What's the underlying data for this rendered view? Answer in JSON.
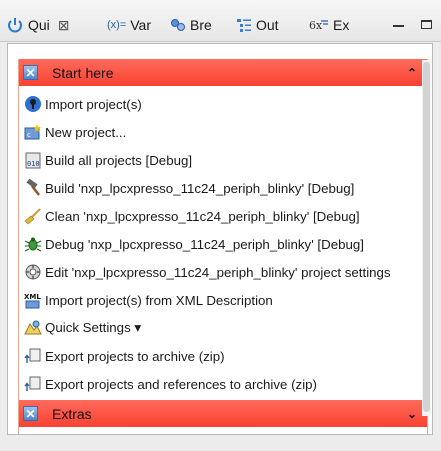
{
  "tabs": [
    {
      "label": "Qui",
      "icon": "power-icon",
      "close": "⊠"
    },
    {
      "label": "Var",
      "icon": "variables-icon",
      "prefix": "(x)="
    },
    {
      "label": "Bre",
      "icon": "breakpoints-icon"
    },
    {
      "label": "Out",
      "icon": "outline-icon"
    },
    {
      "label": "Ex",
      "icon": "expressions-icon"
    }
  ],
  "sections": {
    "start": {
      "title": "Start here",
      "chevron": "⌃"
    },
    "extras": {
      "title": "Extras",
      "chevron": "⌄"
    }
  },
  "items": [
    {
      "label": "Import project(s)",
      "icon": "import-icon"
    },
    {
      "label": "New project...",
      "icon": "new-project-icon"
    },
    {
      "label": "Build all projects [Debug]",
      "icon": "build-all-icon"
    },
    {
      "label": "Build 'nxp_lpcxpresso_11c24_periph_blinky' [Debug]",
      "icon": "hammer-icon"
    },
    {
      "label": "Clean 'nxp_lpcxpresso_11c24_periph_blinky' [Debug]",
      "icon": "broom-icon"
    },
    {
      "label": "Debug 'nxp_lpcxpresso_11c24_periph_blinky' [Debug]",
      "icon": "bug-icon"
    },
    {
      "label": "Edit 'nxp_lpcxpresso_11c24_periph_blinky' project settings",
      "icon": "settings-icon"
    },
    {
      "label": "Import project(s) from XML Description",
      "icon": "xml-icon"
    },
    {
      "label": "Quick Settings ▾",
      "icon": "quick-settings-icon"
    },
    {
      "label": "Export projects to archive (zip)",
      "icon": "export-icon"
    },
    {
      "label": "Export projects and references to archive (zip)",
      "icon": "export-refs-icon"
    }
  ],
  "colors": {
    "section_header": "#f94232",
    "accent_blue": "#4d86cf"
  }
}
